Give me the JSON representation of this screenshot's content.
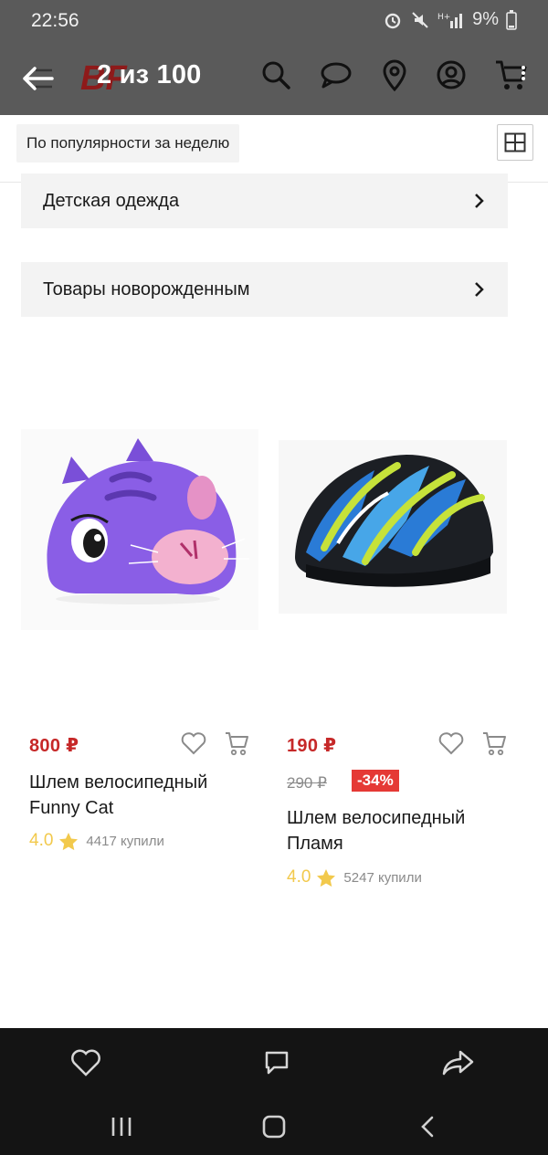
{
  "status_bar": {
    "time": "22:56",
    "battery": "9%"
  },
  "header": {
    "counter": "2 из 100",
    "icons": [
      "back-arrow-icon",
      "search-icon",
      "chat-icon",
      "location-pin-icon",
      "account-icon",
      "cart-icon"
    ]
  },
  "filter": {
    "sort_label": "По популярности за неделю",
    "view_toggle_icon": "grid-icon"
  },
  "categories": [
    {
      "label": "Детская одежда"
    },
    {
      "label": "Товары новорожденным"
    }
  ],
  "products": [
    {
      "price": "800 ₽",
      "title": "Шлем велосипедный Funny Cat",
      "rating": "4.0",
      "buyers": "4417 купили"
    },
    {
      "price": "190 ₽",
      "old_price": "290 ₽",
      "discount": "-34%",
      "title": "Шлем велосипедный Пламя",
      "rating": "4.0",
      "buyers": "5247 купили"
    }
  ],
  "action_bar": {
    "icons": [
      "heart-icon",
      "chat-icon",
      "share-icon"
    ]
  },
  "nav_bar": {
    "icons": [
      "recent-apps-icon",
      "home-icon",
      "back-icon"
    ]
  },
  "colors": {
    "price_red": "#c62828",
    "discount_red": "#e53935",
    "rating_yellow": "#f2c94c",
    "header_dim": "#5a5a5a"
  }
}
